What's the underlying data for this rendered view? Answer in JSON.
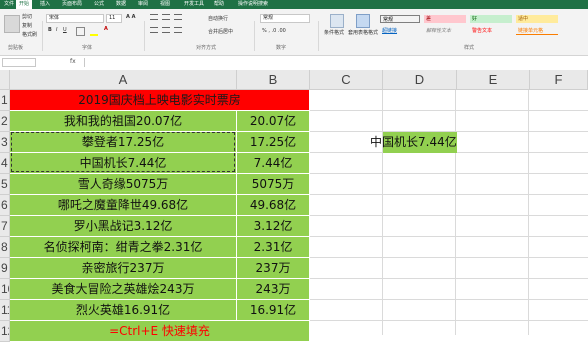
{
  "tabs": [
    "文件",
    "开始",
    "插入",
    "页面布局",
    "公式",
    "数据",
    "审阅",
    "视图",
    "开发工具",
    "帮助",
    "操作说明搜索"
  ],
  "ribbon": {
    "clipboard": {
      "cut": "剪切",
      "copy": "复制",
      "format_painter": "格式刷",
      "group_label": "剪贴板"
    },
    "font": {
      "name": "宋体",
      "size": "11",
      "group_label": "字体"
    },
    "alignment": {
      "wrap": "自动换行",
      "merge": "合并后居中",
      "group_label": "对齐方式"
    },
    "number": {
      "format": "常规",
      "group_label": "数字"
    },
    "styles": {
      "conditional": "条件格式",
      "table": "套用表格格式",
      "group_label": "样式",
      "cells": [
        {
          "label": "常规",
          "bg": "#ffffff",
          "fg": "#000000"
        },
        {
          "label": "差",
          "bg": "#ffc7ce",
          "fg": "#9c0006"
        },
        {
          "label": "好",
          "bg": "#c6efce",
          "fg": "#006100"
        },
        {
          "label": "适中",
          "bg": "#ffeb9c",
          "fg": "#9c5700"
        },
        {
          "label": "超链接",
          "bg": "#ffffff",
          "fg": "#0563c1"
        },
        {
          "label": "解释性文本",
          "bg": "#ffffff",
          "fg": "#7f7f7f"
        },
        {
          "label": "警告文本",
          "bg": "#ffffff",
          "fg": "#ff0000"
        },
        {
          "label": "链接单元格",
          "bg": "#ffffff",
          "fg": "#fa7d00"
        }
      ]
    }
  },
  "formula_bar": {
    "fx": "fx",
    "content": ""
  },
  "columns": [
    "A",
    "B",
    "C",
    "D",
    "E",
    "F"
  ],
  "rows": [
    "1",
    "2",
    "3",
    "4",
    "5",
    "6",
    "7",
    "8",
    "9",
    "10",
    "11",
    "12"
  ],
  "sheet": {
    "title": "2019国庆档上映电影实时票房",
    "entries": [
      {
        "a": "我和我的祖国20.07亿",
        "b": "20.07亿"
      },
      {
        "a": "攀登者17.25亿",
        "b": "17.25亿"
      },
      {
        "a": "中国机长7.44亿",
        "b": "7.44亿"
      },
      {
        "a": "雪人奇缘5075万",
        "b": "5075万"
      },
      {
        "a": "哪吒之魔童降世49.68亿",
        "b": "49.68亿"
      },
      {
        "a": "罗小黑战记3.12亿",
        "b": "3.12亿"
      },
      {
        "a": "名侦探柯南：绀青之拳2.31亿",
        "b": "2.31亿"
      },
      {
        "a": "亲密旅行237万",
        "b": "237万"
      },
      {
        "a": "美食大冒险之英雄烩243万",
        "b": "243万"
      },
      {
        "a": "烈火英雄16.91亿",
        "b": "16.91亿"
      }
    ],
    "footer": "=Ctrl+E 快速填充",
    "d3": "中国机长7.44亿"
  },
  "colors": {
    "header_red": "#ff0000",
    "cell_green": "#92d050",
    "excel_green": "#1f7145",
    "footer_text": "#ff0000"
  }
}
